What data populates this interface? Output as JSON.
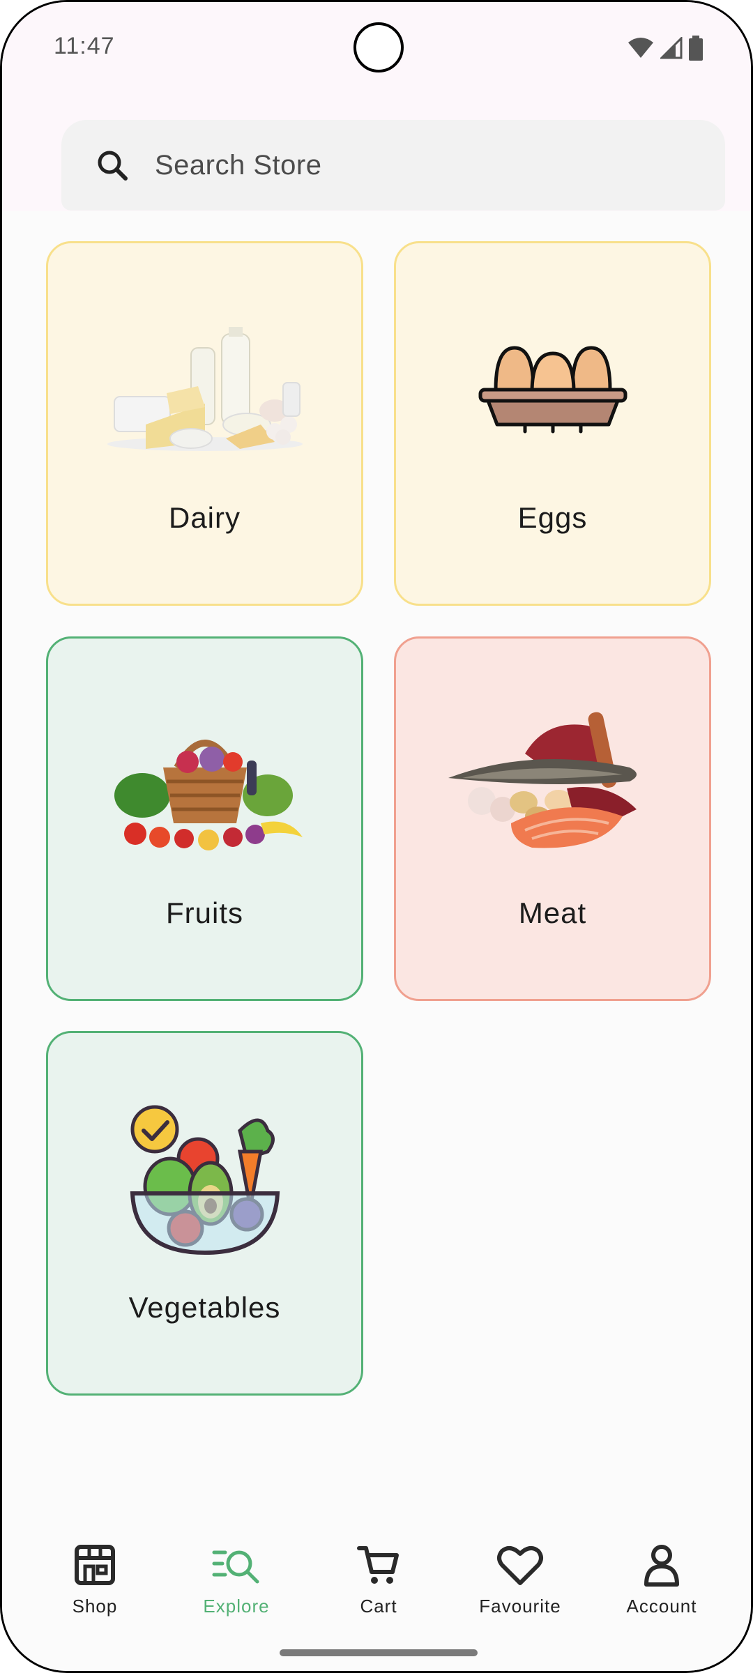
{
  "status_bar": {
    "time": "11:47"
  },
  "search": {
    "placeholder": "Search Store"
  },
  "categories": [
    {
      "label": "Dairy",
      "image": "dairy-products-image",
      "bg": "#fdf6e3",
      "border": "#f8e08b"
    },
    {
      "label": "Eggs",
      "image": "egg-carton-icon",
      "bg": "#fdf6e3",
      "border": "#f8e08b"
    },
    {
      "label": "Fruits",
      "image": "fruit-basket-image",
      "bg": "#e9f3ee",
      "border": "#53b175"
    },
    {
      "label": "Meat",
      "image": "meat-and-fish-image",
      "bg": "#fbe6e2",
      "border": "#f0a08f"
    },
    {
      "label": "Vegetables",
      "image": "vegetable-bowl-icon",
      "bg": "#e9f3ee",
      "border": "#53b175"
    }
  ],
  "bottom_nav": {
    "active": "Explore",
    "accent": "#53b175",
    "items": [
      {
        "label": "Shop",
        "icon": "store-icon"
      },
      {
        "label": "Explore",
        "icon": "explore-search-icon"
      },
      {
        "label": "Cart",
        "icon": "cart-icon"
      },
      {
        "label": "Favourite",
        "icon": "heart-icon"
      },
      {
        "label": "Account",
        "icon": "person-icon"
      }
    ]
  }
}
